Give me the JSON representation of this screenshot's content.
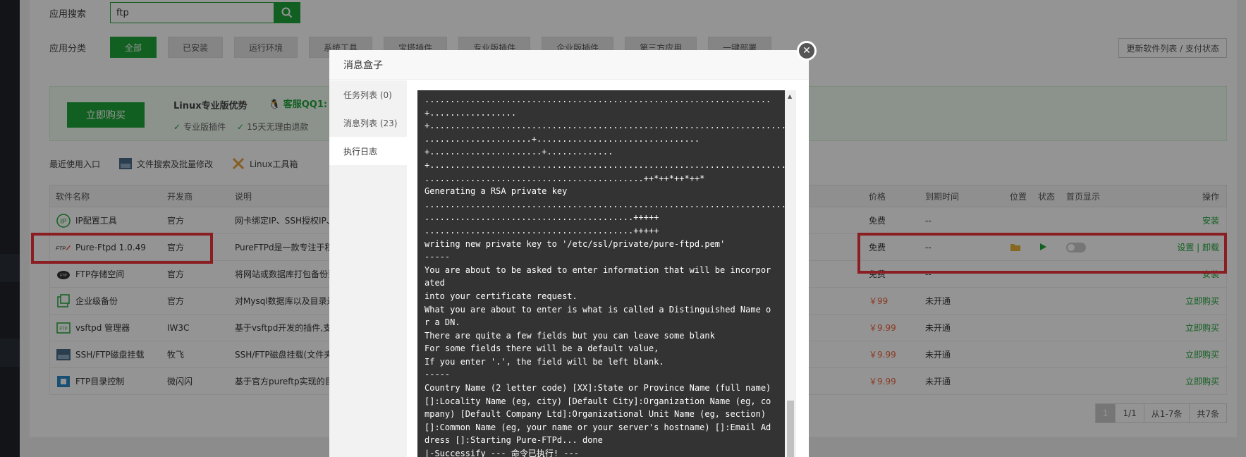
{
  "search": {
    "label": "应用搜索",
    "value": "ftp"
  },
  "categories": {
    "label": "应用分类",
    "items": [
      "全部",
      "已安装",
      "运行环境",
      "系统工具",
      "宝塔插件",
      "专业版插件",
      "企业版插件",
      "第三方应用",
      "一键部署"
    ],
    "active_index": 0
  },
  "update_button": "更新软件列表 / 支付状态",
  "promo": {
    "buy_button": "立即购买",
    "title": "Linux专业版优势",
    "qq": "客服QQ1:",
    "features": [
      "专业版插件",
      "15天无理由退款"
    ]
  },
  "recent": {
    "label": "最近使用入口",
    "items": [
      "文件搜索及批量修改",
      "Linux工具箱"
    ]
  },
  "table": {
    "headers": {
      "name": "软件名称",
      "dev": "开发商",
      "desc": "说明",
      "price": "价格",
      "expiry": "到期时间",
      "position": "位置",
      "status": "状态",
      "home": "首页显示",
      "op": "操作"
    },
    "rows": [
      {
        "name": "IP配置工具",
        "dev": "官方",
        "desc": "网卡绑定IP、SSH授权IP、",
        "price": "免费",
        "expiry": "--",
        "op": "安装",
        "icon": "ip-config-icon"
      },
      {
        "name": "Pure-Ftpd 1.0.49",
        "dev": "官方",
        "desc": "PureFTPd是一款专注于程序",
        "price": "免费",
        "expiry": "--",
        "op": "设置 | 卸载",
        "icon": "ftp-icon"
      },
      {
        "name": "FTP存储空间",
        "dev": "官方",
        "desc": "将网站或数据库打包备份到",
        "price": "免费",
        "expiry": "--",
        "op": "安装",
        "icon": "ftp-cloud-icon"
      },
      {
        "name": "企业级备份",
        "dev": "官方",
        "desc": "对Mysql数据库以及目录进",
        "price": "￥99",
        "expiry": "未开通",
        "op": "立即购买",
        "icon": "backup-icon"
      },
      {
        "name": "vsftpd 管理器",
        "dev": "IW3C",
        "desc": "基于vsftpd开发的插件,支持",
        "price": "￥9.99",
        "expiry": "未开通",
        "op": "立即购买",
        "icon": "vsftpd-icon"
      },
      {
        "name": "SSH/FTP磁盘挂载",
        "dev": "牧飞",
        "desc": "SSH/FTP磁盘挂载(文件夹可",
        "price": "￥9.99",
        "expiry": "未开通",
        "op": "立即购买",
        "icon": "disk-mount-icon"
      },
      {
        "name": "FTP目录控制",
        "dev": "微闪闪",
        "desc": "基于官方pureftp实现的目录",
        "price": "￥9.99",
        "expiry": "未开通",
        "op": "立即购买",
        "icon": "ftp-dir-icon"
      }
    ]
  },
  "pager": {
    "current": "1",
    "pages": "1/1",
    "range": "从1-7条",
    "total": "共7条"
  },
  "modal": {
    "title": "消息盒子",
    "tabs": [
      "任务列表 (0)",
      "消息列表 (23)",
      "执行日志"
    ],
    "active_tab": 2,
    "log": "....................................................................\n+.................\n+.......................................................................\n.....................+................................\n+......................+.............\n+.......................................................................\n...........................................++*++*++*++*\nGenerating a RSA private key\n........................................................................\n.........................................+++++\n.........................................+++++\nwriting new private key to '/etc/ssl/private/pure-ftpd.pem'\n-----\nYou are about to be asked to enter information that will be incorporated\ninto your certificate request.\nWhat you are about to enter is what is called a Distinguished Name or a DN.\nThere are quite a few fields but you can leave some blank\nFor some fields there will be a default value,\nIf you enter '.', the field will be left blank.\n-----\nCountry Name (2 letter code) [XX]:State or Province Name (full name) []:Locality Name (eg, city) [Default City]:Organization Name (eg, company) [Default Company Ltd]:Organizational Unit Name (eg, section) []:Common Name (eg, your name or your server's hostname) []:Email Address []:Starting Pure-FTPd... done\n|-Successify --- 命令已执行! ---"
  },
  "colors": {
    "accent": "#20a53a",
    "price_red": "#f0643c",
    "highlight_red": "#f0343c",
    "log_bg": "#333333"
  }
}
